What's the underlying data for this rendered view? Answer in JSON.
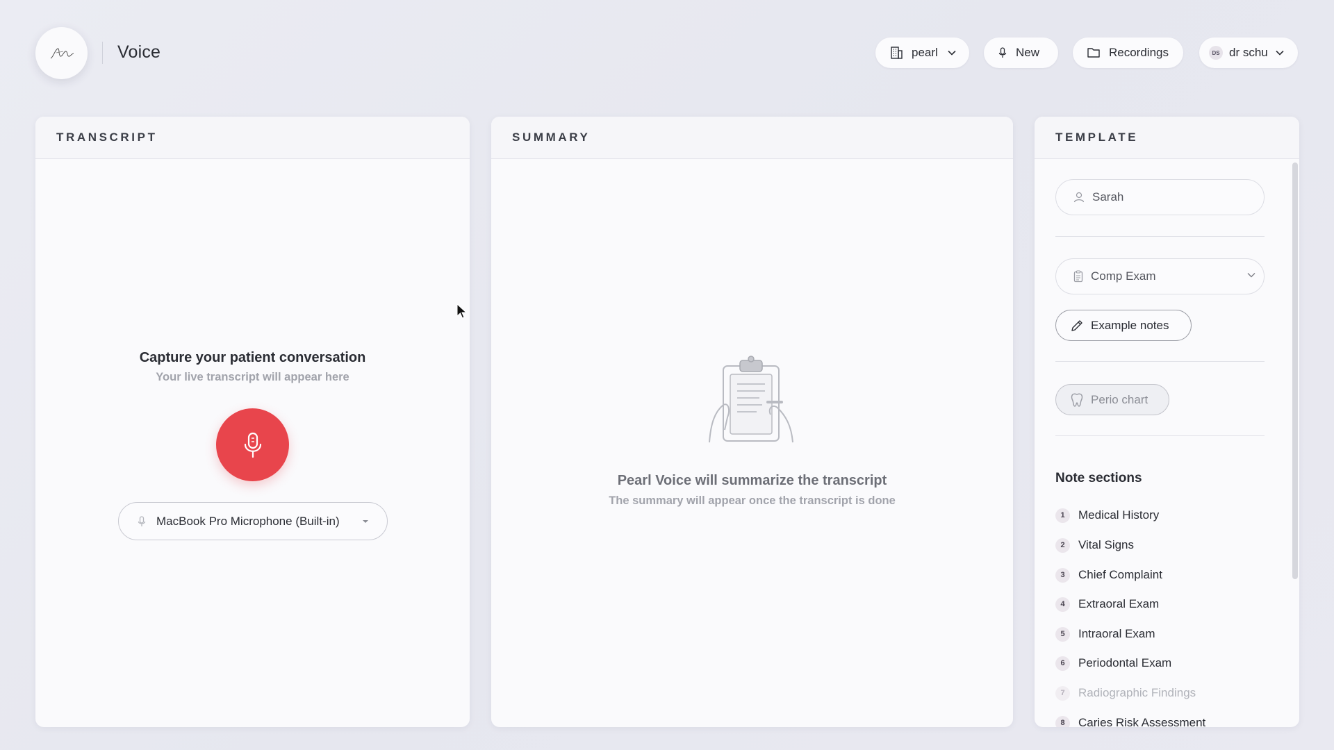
{
  "header": {
    "app_title": "Voice",
    "workspace_label": "pearl",
    "new_label": "New",
    "recordings_label": "Recordings",
    "user_initials": "DS",
    "user_label": "dr schu"
  },
  "transcript": {
    "heading": "TRANSCRIPT",
    "title": "Capture your patient conversation",
    "subtitle": "Your live transcript will appear here",
    "microphone": "MacBook Pro Microphone (Built-in)"
  },
  "summary": {
    "heading": "SUMMARY",
    "title": "Pearl Voice will summarize the transcript",
    "subtitle": "The summary will appear once the transcript is done"
  },
  "template": {
    "heading": "TEMPLATE",
    "patient_name": "Sarah",
    "selected_template": "Comp Exam",
    "example_notes_label": "Example notes",
    "perio_chart_label": "Perio chart",
    "note_sections_heading": "Note sections",
    "note_sections": [
      {
        "num": "1",
        "label": "Medical History"
      },
      {
        "num": "2",
        "label": "Vital Signs"
      },
      {
        "num": "3",
        "label": "Chief Complaint"
      },
      {
        "num": "4",
        "label": "Extraoral Exam"
      },
      {
        "num": "5",
        "label": "Intraoral Exam"
      },
      {
        "num": "6",
        "label": "Periodontal Exam"
      },
      {
        "num": "7",
        "label": "Radiographic Findings"
      },
      {
        "num": "8",
        "label": "Caries Risk Assessment"
      }
    ]
  },
  "colors": {
    "record_button": "#e8454c",
    "background": "#e9eaf1",
    "panel": "#fafafc"
  }
}
